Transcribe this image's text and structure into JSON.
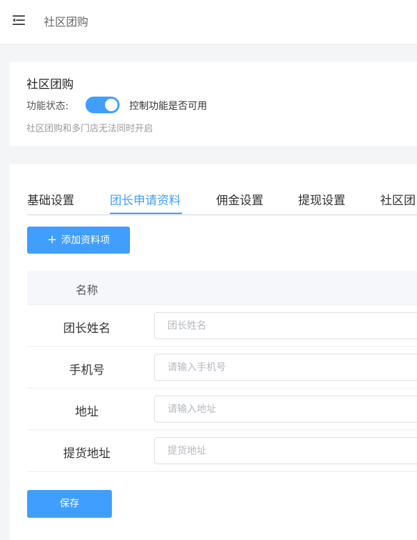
{
  "header": {
    "title": "社区团购"
  },
  "info": {
    "title": "社区团购",
    "status_label": "功能状态:",
    "status_on": true,
    "status_desc": "控制功能是否可用",
    "note": "社区团购和多门店无法同时开启"
  },
  "tabs": [
    {
      "label": "基础设置"
    },
    {
      "label": "团长申请资料"
    },
    {
      "label": "佣金设置"
    },
    {
      "label": "提现设置"
    },
    {
      "label": "社区团"
    }
  ],
  "active_tab": 1,
  "add_button": {
    "icon": "+",
    "label": "添加资料项"
  },
  "table": {
    "header": "名称",
    "rows": [
      {
        "label": "团长姓名",
        "placeholder": "团长姓名"
      },
      {
        "label": "手机号",
        "placeholder": "请输入手机号"
      },
      {
        "label": "地址",
        "placeholder": "请输入地址"
      },
      {
        "label": "提货地址",
        "placeholder": "提货地址"
      }
    ]
  },
  "save_button": {
    "label": "保存"
  },
  "colors": {
    "accent": "#409eff"
  }
}
